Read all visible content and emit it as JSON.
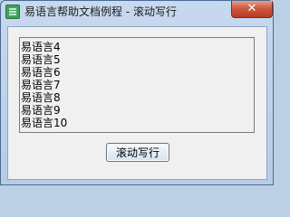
{
  "window": {
    "title": "易语言帮助文档例程 - 滚动写行",
    "close_label": "✕",
    "app_icon": "easy-language-icon"
  },
  "listbox": {
    "items": [
      "易语言4",
      "易语言5",
      "易语言6",
      "易语言7",
      "易语言8",
      "易语言9",
      "易语言10"
    ]
  },
  "button": {
    "label": "滚动写行"
  }
}
